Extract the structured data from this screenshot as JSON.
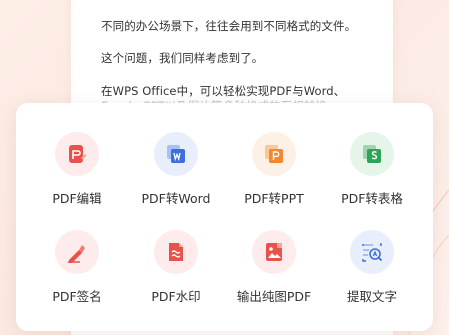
{
  "document": {
    "lines": [
      "不同的办公场景下，往往会用到不同格式的文件。",
      "这个问题，我们同样考虑到了。",
      "在WPS Office中，可以轻松实现PDF与Word、",
      "Excel、PPT以及图片等多种格式的互相转换。"
    ]
  },
  "tools": [
    {
      "label": "PDF编辑",
      "icon": "pdf-edit-icon",
      "color": "#e9524a"
    },
    {
      "label": "PDF转Word",
      "icon": "pdf-to-word-icon",
      "color": "#3d6fe0"
    },
    {
      "label": "PDF转PPT",
      "icon": "pdf-to-ppt-icon",
      "color": "#f0892f"
    },
    {
      "label": "PDF转表格",
      "icon": "pdf-to-excel-icon",
      "color": "#2fa35a"
    },
    {
      "label": "PDF签名",
      "icon": "pdf-sign-icon",
      "color": "#e9524a"
    },
    {
      "label": "PDF水印",
      "icon": "pdf-watermark-icon",
      "color": "#e9524a"
    },
    {
      "label": "输出纯图PDF",
      "icon": "export-image-pdf-icon",
      "color": "#e9524a"
    },
    {
      "label": "提取文字",
      "icon": "extract-text-icon",
      "color": "#3d6fe0"
    }
  ]
}
